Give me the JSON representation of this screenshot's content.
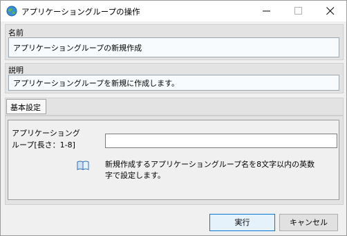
{
  "window": {
    "title": "アプリケーショングループの操作",
    "icons": {
      "app": "globe-icon",
      "minimize": "minimize-icon",
      "maximize": "maximize-icon",
      "close": "close-icon"
    }
  },
  "name_section": {
    "label": "名前",
    "value": "アプリケーショングループの新規作成"
  },
  "description_section": {
    "label": "説明",
    "value": "アプリケーショングループを新規に作成します。"
  },
  "tabs": [
    {
      "label": "基本設定",
      "selected": true
    }
  ],
  "form": {
    "field_label_line1": "アプリケーショング",
    "field_label_line2": "ループ[長さ：1-8]",
    "field_value": "",
    "help_icon": "book-icon",
    "help_line1": "新規作成するアプリケーショングループ名を8文字以内の英数",
    "help_line2": "字で設定します。"
  },
  "buttons": {
    "execute": "実行",
    "cancel": "キャンセル"
  },
  "colors": {
    "accent": "#0078d7",
    "field_bg": "#f7fbfd",
    "section_bg": "#e3e3e3"
  }
}
